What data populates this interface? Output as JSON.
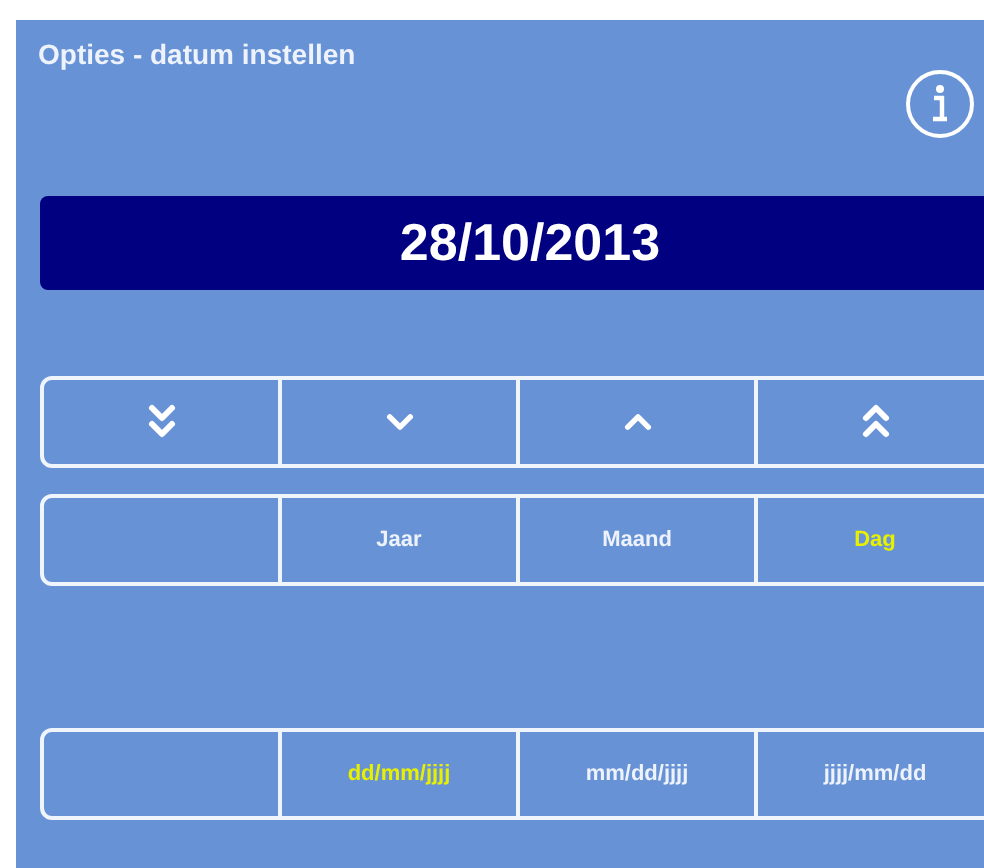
{
  "window": {
    "title": "Opties - datum instellen"
  },
  "date": "28/10/2013",
  "steps": [
    {
      "kind": "double-down"
    },
    {
      "kind": "down"
    },
    {
      "kind": "up"
    },
    {
      "kind": "double-up"
    }
  ],
  "fields": [
    {
      "label": "Jaar",
      "selected": false
    },
    {
      "label": "Maand",
      "selected": false
    },
    {
      "label": "Dag",
      "selected": true
    }
  ],
  "formats": [
    {
      "label": "dd/mm/jjjj",
      "selected": true
    },
    {
      "label": "mm/dd/jjjj",
      "selected": false
    },
    {
      "label": "jjjj/mm/dd",
      "selected": false
    }
  ]
}
